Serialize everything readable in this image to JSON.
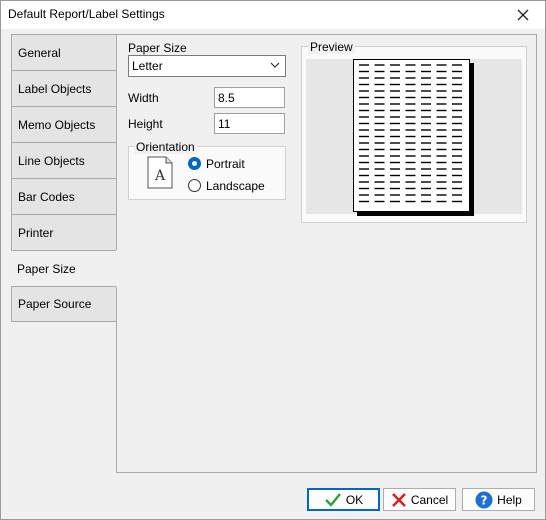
{
  "window": {
    "title": "Default Report/Label Settings"
  },
  "tabs": [
    {
      "label": "General"
    },
    {
      "label": "Label Objects"
    },
    {
      "label": "Memo Objects"
    },
    {
      "label": "Line Objects"
    },
    {
      "label": "Bar Codes"
    },
    {
      "label": "Printer"
    },
    {
      "label": "Paper Size",
      "active": true
    },
    {
      "label": "Paper Source"
    }
  ],
  "paper": {
    "size_label": "Paper Size",
    "size_value": "Letter",
    "width_label": "Width",
    "width_value": "8.5",
    "height_label": "Height",
    "height_value": "11",
    "orientation_label": "Orientation",
    "portrait_label": "Portrait",
    "landscape_label": "Landscape",
    "orientation_selected": "Portrait",
    "orientation_icon_letter": "A"
  },
  "preview": {
    "label": "Preview"
  },
  "buttons": {
    "ok": "OK",
    "cancel": "Cancel",
    "help": "Help"
  },
  "colors": {
    "accent": "#0067c0",
    "ok_check": "#2e9e3e",
    "cancel_x": "#d32020",
    "help_circle": "#1f6fd0"
  }
}
